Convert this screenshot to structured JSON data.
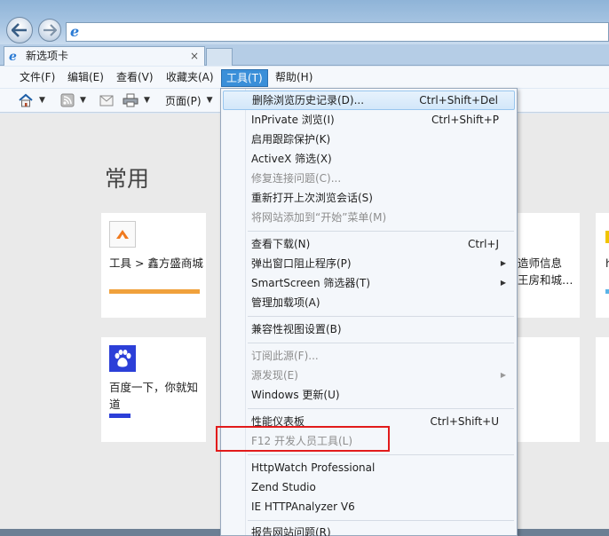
{
  "address": {
    "value": ""
  },
  "tab": {
    "title": "新选项卡",
    "close": "×"
  },
  "menubar": [
    {
      "label": "文件(F)"
    },
    {
      "label": "编辑(E)"
    },
    {
      "label": "查看(V)"
    },
    {
      "label": "收藏夹(A)"
    },
    {
      "label": "工具(T)"
    },
    {
      "label": "帮助(H)"
    }
  ],
  "cmdbar": {
    "page_label": "页面(P)"
  },
  "content": {
    "section_title": "常用",
    "tiles": [
      {
        "label": "工具 > 鑫方盛商城",
        "accent": "#f0a13c"
      },
      {
        "label": "百度一下，你就知道",
        "accent": "#2c3fd8"
      },
      {
        "label": "造师信息\n王房和城…"
      },
      {
        "label": "h"
      }
    ]
  },
  "tools_menu": {
    "items": [
      {
        "label": "删除浏览历史记录(D)...",
        "shortcut": "Ctrl+Shift+Del",
        "disabled": false
      },
      {
        "label": "InPrivate 浏览(I)",
        "shortcut": "Ctrl+Shift+P",
        "disabled": false
      },
      {
        "label": "启用跟踪保护(K)",
        "shortcut": "",
        "disabled": false
      },
      {
        "label": "ActiveX 筛选(X)",
        "shortcut": "",
        "disabled": false
      },
      {
        "label": "修复连接问题(C)...",
        "shortcut": "",
        "disabled": true
      },
      {
        "label": "重新打开上次浏览会话(S)",
        "shortcut": "",
        "disabled": false
      },
      {
        "label": "将网站添加到“开始”菜单(M)",
        "shortcut": "",
        "disabled": true
      },
      {
        "label": "查看下载(N)",
        "shortcut": "Ctrl+J",
        "disabled": false
      },
      {
        "label": "弹出窗口阻止程序(P)",
        "shortcut": "",
        "disabled": false,
        "submenu": true
      },
      {
        "label": "SmartScreen 筛选器(T)",
        "shortcut": "",
        "disabled": false,
        "submenu": true
      },
      {
        "label": "管理加载项(A)",
        "shortcut": "",
        "disabled": false
      },
      {
        "label": "兼容性视图设置(B)",
        "shortcut": "",
        "disabled": false
      },
      {
        "label": "订阅此源(F)...",
        "shortcut": "",
        "disabled": true
      },
      {
        "label": "源发现(E)",
        "shortcut": "",
        "disabled": true,
        "submenu": true
      },
      {
        "label": "Windows 更新(U)",
        "shortcut": "",
        "disabled": false
      },
      {
        "label": "性能仪表板",
        "shortcut": "Ctrl+Shift+U",
        "disabled": false
      },
      {
        "label": "F12 开发人员工具(L)",
        "shortcut": "",
        "disabled": true
      },
      {
        "label": "HttpWatch Professional",
        "shortcut": "",
        "disabled": false
      },
      {
        "label": "Zend Studio",
        "shortcut": "",
        "disabled": false
      },
      {
        "label": "IE HTTPAnalyzer V6",
        "shortcut": "",
        "disabled": false
      },
      {
        "label": "报告网站问题(R)",
        "shortcut": "",
        "disabled": false
      }
    ],
    "submenu_glyph": "▶"
  },
  "colors": {
    "highlight_box": "#e21b1b",
    "menu_active": "#3a8fd9"
  }
}
